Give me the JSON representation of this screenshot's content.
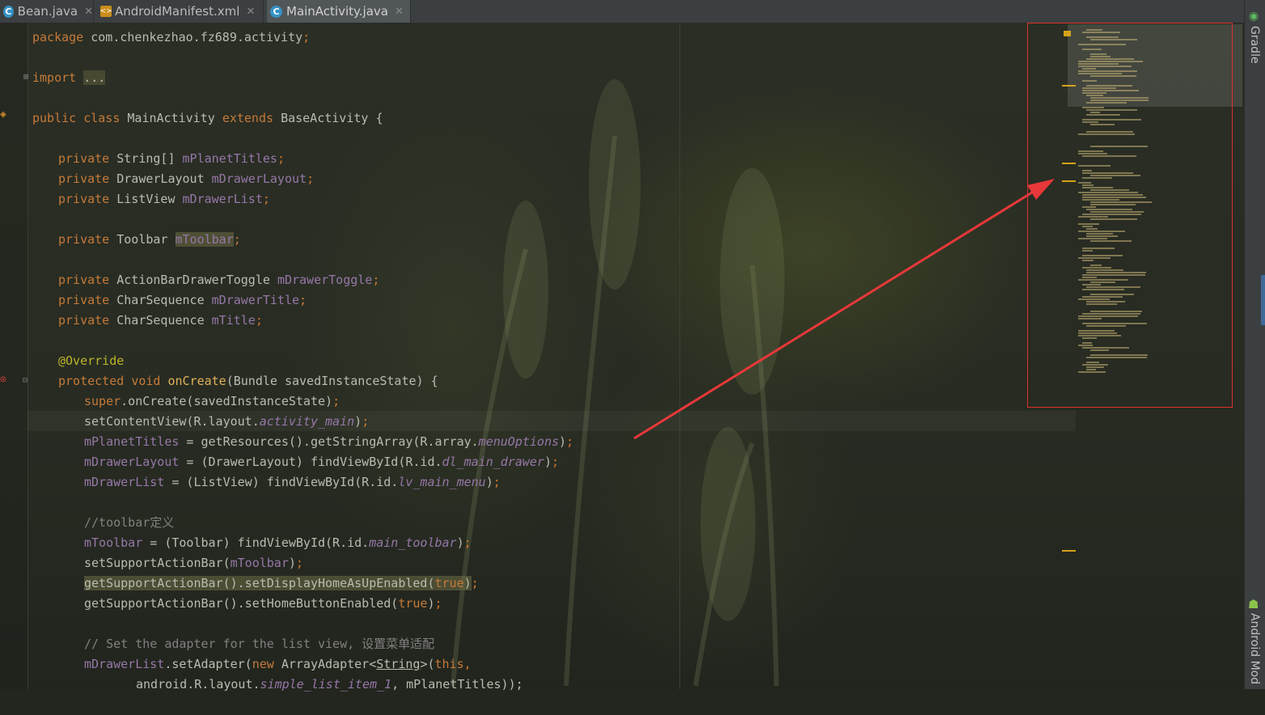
{
  "tabs": [
    {
      "label": "Bean.java",
      "icon": "class-icon",
      "active": false
    },
    {
      "label": "AndroidManifest.xml",
      "icon": "xml-icon",
      "active": false
    },
    {
      "label": "MainActivity.java",
      "icon": "class-icon",
      "active": true
    }
  ],
  "sidebar": {
    "gradle_label": "Gradle",
    "android_label": "Android Mod"
  },
  "colors": {
    "keyword": "#c57a3a",
    "field": "#9677a8",
    "method": "#e0b25a",
    "comment": "#808080",
    "annotation": "#bbb529",
    "arrow": "#e8383a"
  },
  "code": {
    "package_kw": "package",
    "package_name": " com.chenkezhao.fz689.activity",
    "semi": ";",
    "import_kw": "import",
    "import_fold": "...",
    "public_kw": "public",
    "class_kw": "class",
    "class_name": "MainActivity",
    "extends_kw": "extends",
    "base_class": "BaseActivity",
    "brace_open": "{",
    "private_kw": "private",
    "f1_type": "String[]",
    "f1_name": "mPlanetTitles",
    "f2_type": "DrawerLayout",
    "f2_name": "mDrawerLayout",
    "f3_type": "ListView",
    "f3_name": "mDrawerList",
    "f4_type": "Toolbar",
    "f4_name": "mToolbar",
    "f5_type": "ActionBarDrawerToggle",
    "f5_name": "mDrawerToggle",
    "f6_type": "CharSequence",
    "f6_name": "mDrawerTitle",
    "f7_type": "CharSequence",
    "f7_name": "mTitle",
    "override": "@Override",
    "protected_kw": "protected",
    "void_kw": "void",
    "oncreate": "onCreate",
    "oncreate_params": "(Bundle savedInstanceState) {",
    "super_kw": "super",
    "super_call": ".onCreate(savedInstanceState)",
    "l_setcontent": "setContentView(R.layout.",
    "r_activity_main": "activity_main",
    "l_titles": " = getResources().getStringArray(R.array.",
    "r_menu_options": "menuOptions",
    "l_drawer": " = (DrawerLayout) findViewById(R.id.",
    "r_dl_main_drawer": "dl_main_drawer",
    "l_list": " = (ListView) findViewById(R.id.",
    "r_lv_main_menu": "lv_main_menu",
    "close_paren": ")",
    "comment_toolbar": "//toolbar定义",
    "l_toolbar": " = (Toolbar) findViewById(R.id.",
    "r_main_toolbar": "main_toolbar",
    "l_setsupport": "setSupportActionBar(",
    "l_gsab": "getSupportActionBar().setDisplayHomeAsUpEnabled(",
    "l_gsab2": "getSupportActionBar().setHomeButtonEnabled(",
    "true_kw": "true",
    "comment_adapter": "// Set the adapter for the list view, 设置菜单适配",
    "l_setadapter": ".setAdapter(",
    "new_kw": "new",
    "adapter_type": " ArrayAdapter<",
    "adapter_generic": "String",
    "adapter_rest": ">(",
    "this_kw": "this",
    "comma": ",",
    "l_android": "android.R.layout.",
    "r_simple_list": "simple_list_item_1",
    "l_tail": ", mPlanetTitles));"
  }
}
